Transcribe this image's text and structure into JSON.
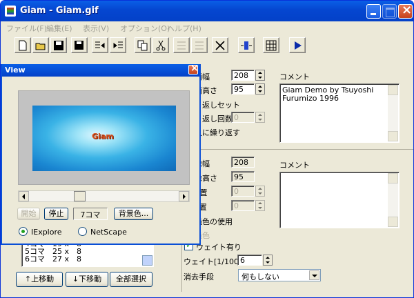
{
  "window": {
    "title": "Giam - Giam.gif"
  },
  "menu": [
    "ファイル(F)",
    "編集(E)",
    "表示(V)",
    "オプション(O)",
    "ヘルプ(H)"
  ],
  "toolbar": {
    "buttons": [
      "new-icon",
      "open-icon",
      "save-icon",
      "save-as-icon",
      "insert-icon",
      "add-icon",
      "copy-icon",
      "cut-icon",
      "paste-icon",
      "paste-after-icon",
      "delete-icon",
      "fit-icon",
      "grid-icon",
      "play-icon"
    ]
  },
  "screen": {
    "width_label": "画面幅",
    "width_value": "208",
    "height_label": "画面高さ",
    "height_value": "95",
    "loop_label": "繰り返しセット",
    "loop_count_label": "繰り返し回数",
    "loop_count_value": "0",
    "forever_label": "永久に繰り返す",
    "comment_label": "コメント",
    "comment_text": "Giam Demo by Tsuyoshi Furumizo 1996"
  },
  "image": {
    "width_label": "画像幅",
    "width_value": "208",
    "height_label": "画像高さ",
    "height_value": "95",
    "xpos_label": "X位置",
    "xpos_value": "0",
    "ypos_label": "Y位置",
    "ypos_value": "0",
    "transparent_label": "透過色の使用",
    "color_label": "透過色",
    "comment_label": "コメント",
    "wait_check_label": "ウェイト有り",
    "wait_label": "ウェイト[1/100s]",
    "wait_value": "6",
    "dispose_label": "消去手段",
    "dispose_value": "何もしない"
  },
  "frames": {
    "items": [
      "4コマ　19 x　8",
      "5コマ　25 x　8",
      "6コマ　27 x　8"
    ],
    "up_button": "↑上移動",
    "down_button": "↓下移動",
    "select_all_button": "全部選択"
  },
  "view": {
    "title": "View",
    "preview_text": "Giam",
    "start_button": "開始",
    "stop_button": "停止",
    "frame_count": "7コマ",
    "bg_button": "背景色...",
    "radio_ie": "IExplore",
    "radio_ns": "NetScape"
  }
}
